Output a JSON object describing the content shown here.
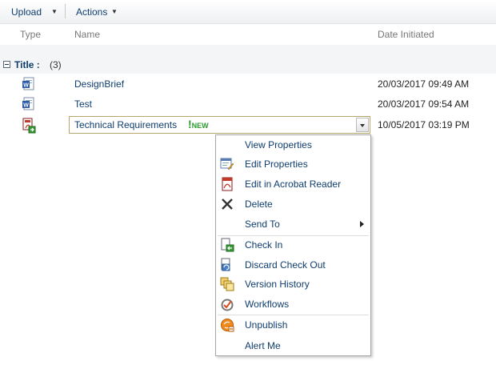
{
  "toolbar": {
    "upload_label": "Upload",
    "actions_label": "Actions"
  },
  "columns": {
    "type": "Type",
    "name": "Name",
    "date": "Date Initiated"
  },
  "group": {
    "label": "Title :",
    "count": "(3)"
  },
  "rows": [
    {
      "name": "DesignBrief",
      "date": "20/03/2017 09:49 AM",
      "icon": "word-doc-icon"
    },
    {
      "name": "Test",
      "date": "20/03/2017 09:54 AM",
      "icon": "word-doc-icon"
    },
    {
      "name": "Technical Requirements",
      "date": "10/05/2017 03:19 PM",
      "icon": "pdf-checked-out-icon",
      "badge": "NEW",
      "badge_mark": "!"
    }
  ],
  "menu": {
    "items": [
      {
        "label": "View Properties",
        "icon": "none"
      },
      {
        "label": "Edit Properties",
        "icon": "edit-properties-icon"
      },
      {
        "label": "Edit in Acrobat Reader",
        "icon": "pdf-icon"
      },
      {
        "label": "Delete",
        "icon": "delete-x-icon"
      },
      {
        "label": "Send To",
        "icon": "none",
        "has_submenu": true
      },
      {
        "label": "Check In",
        "icon": "check-in-icon"
      },
      {
        "label": "Discard Check Out",
        "icon": "discard-checkout-icon"
      },
      {
        "label": "Version History",
        "icon": "version-history-icon"
      },
      {
        "label": "Workflows",
        "icon": "workflows-icon"
      },
      {
        "label": "Unpublish",
        "icon": "unpublish-icon"
      },
      {
        "label": "Alert Me",
        "icon": "none"
      }
    ]
  },
  "colors": {
    "link": "#0f3d6e",
    "new_badge": "#2e9a2e",
    "edit_border": "#b9a46a"
  }
}
